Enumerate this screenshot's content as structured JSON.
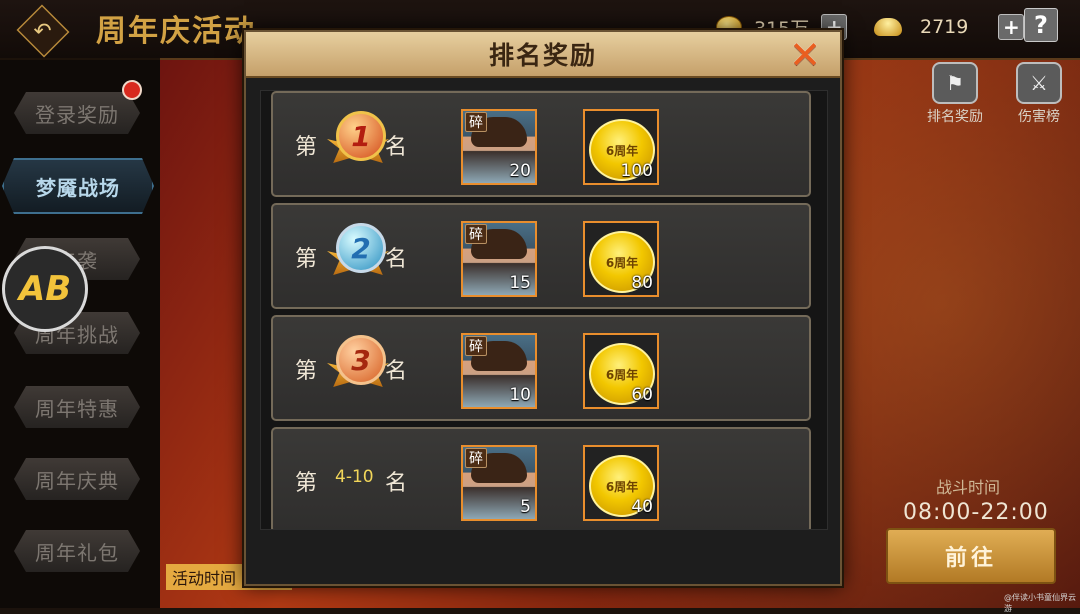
{
  "topbar": {
    "back_icon": "back-arrow-icon",
    "event_title": "周年庆活动",
    "coins_value": "315万",
    "ingots_value": "2719",
    "plus_label": "+",
    "help_label": "?"
  },
  "sidebar": {
    "items": [
      {
        "label": "登录奖励",
        "active": false
      },
      {
        "label": "梦魇战场",
        "active": true
      },
      {
        "label": "来袭",
        "active": false
      },
      {
        "label": "周年挑战",
        "active": false
      },
      {
        "label": "周年特惠",
        "active": false
      },
      {
        "label": "周年庆典",
        "active": false
      },
      {
        "label": "周年礼包",
        "active": false
      }
    ]
  },
  "overlay": {
    "ab_badge": "AB"
  },
  "right_panel": {
    "rank_reward_label": "排名奖励",
    "damage_rank_label": "伤害榜",
    "battle_time_label": "战斗时间",
    "battle_time_value": "08:00-22:00",
    "goto_button_label": "前往",
    "activity_text": "活动时间"
  },
  "modal": {
    "title": "排名奖励",
    "close_icon": "close-x-icon",
    "rows": [
      {
        "prefix": "第",
        "rank": "1",
        "suffix": "名",
        "hero_qty": "20",
        "coin_qty": "100"
      },
      {
        "prefix": "第",
        "rank": "2",
        "suffix": "名",
        "hero_qty": "15",
        "coin_qty": "80"
      },
      {
        "prefix": "第",
        "rank": "3",
        "suffix": "名",
        "hero_qty": "10",
        "coin_qty": "60"
      },
      {
        "prefix": "第",
        "range": "4-10",
        "suffix": "名",
        "hero_qty": "5",
        "coin_qty": "40"
      }
    ],
    "item_labels": {
      "shard_tag": "碎",
      "coin_mark": "6周年"
    }
  },
  "watermark": "@伴读小书童仙界云游"
}
